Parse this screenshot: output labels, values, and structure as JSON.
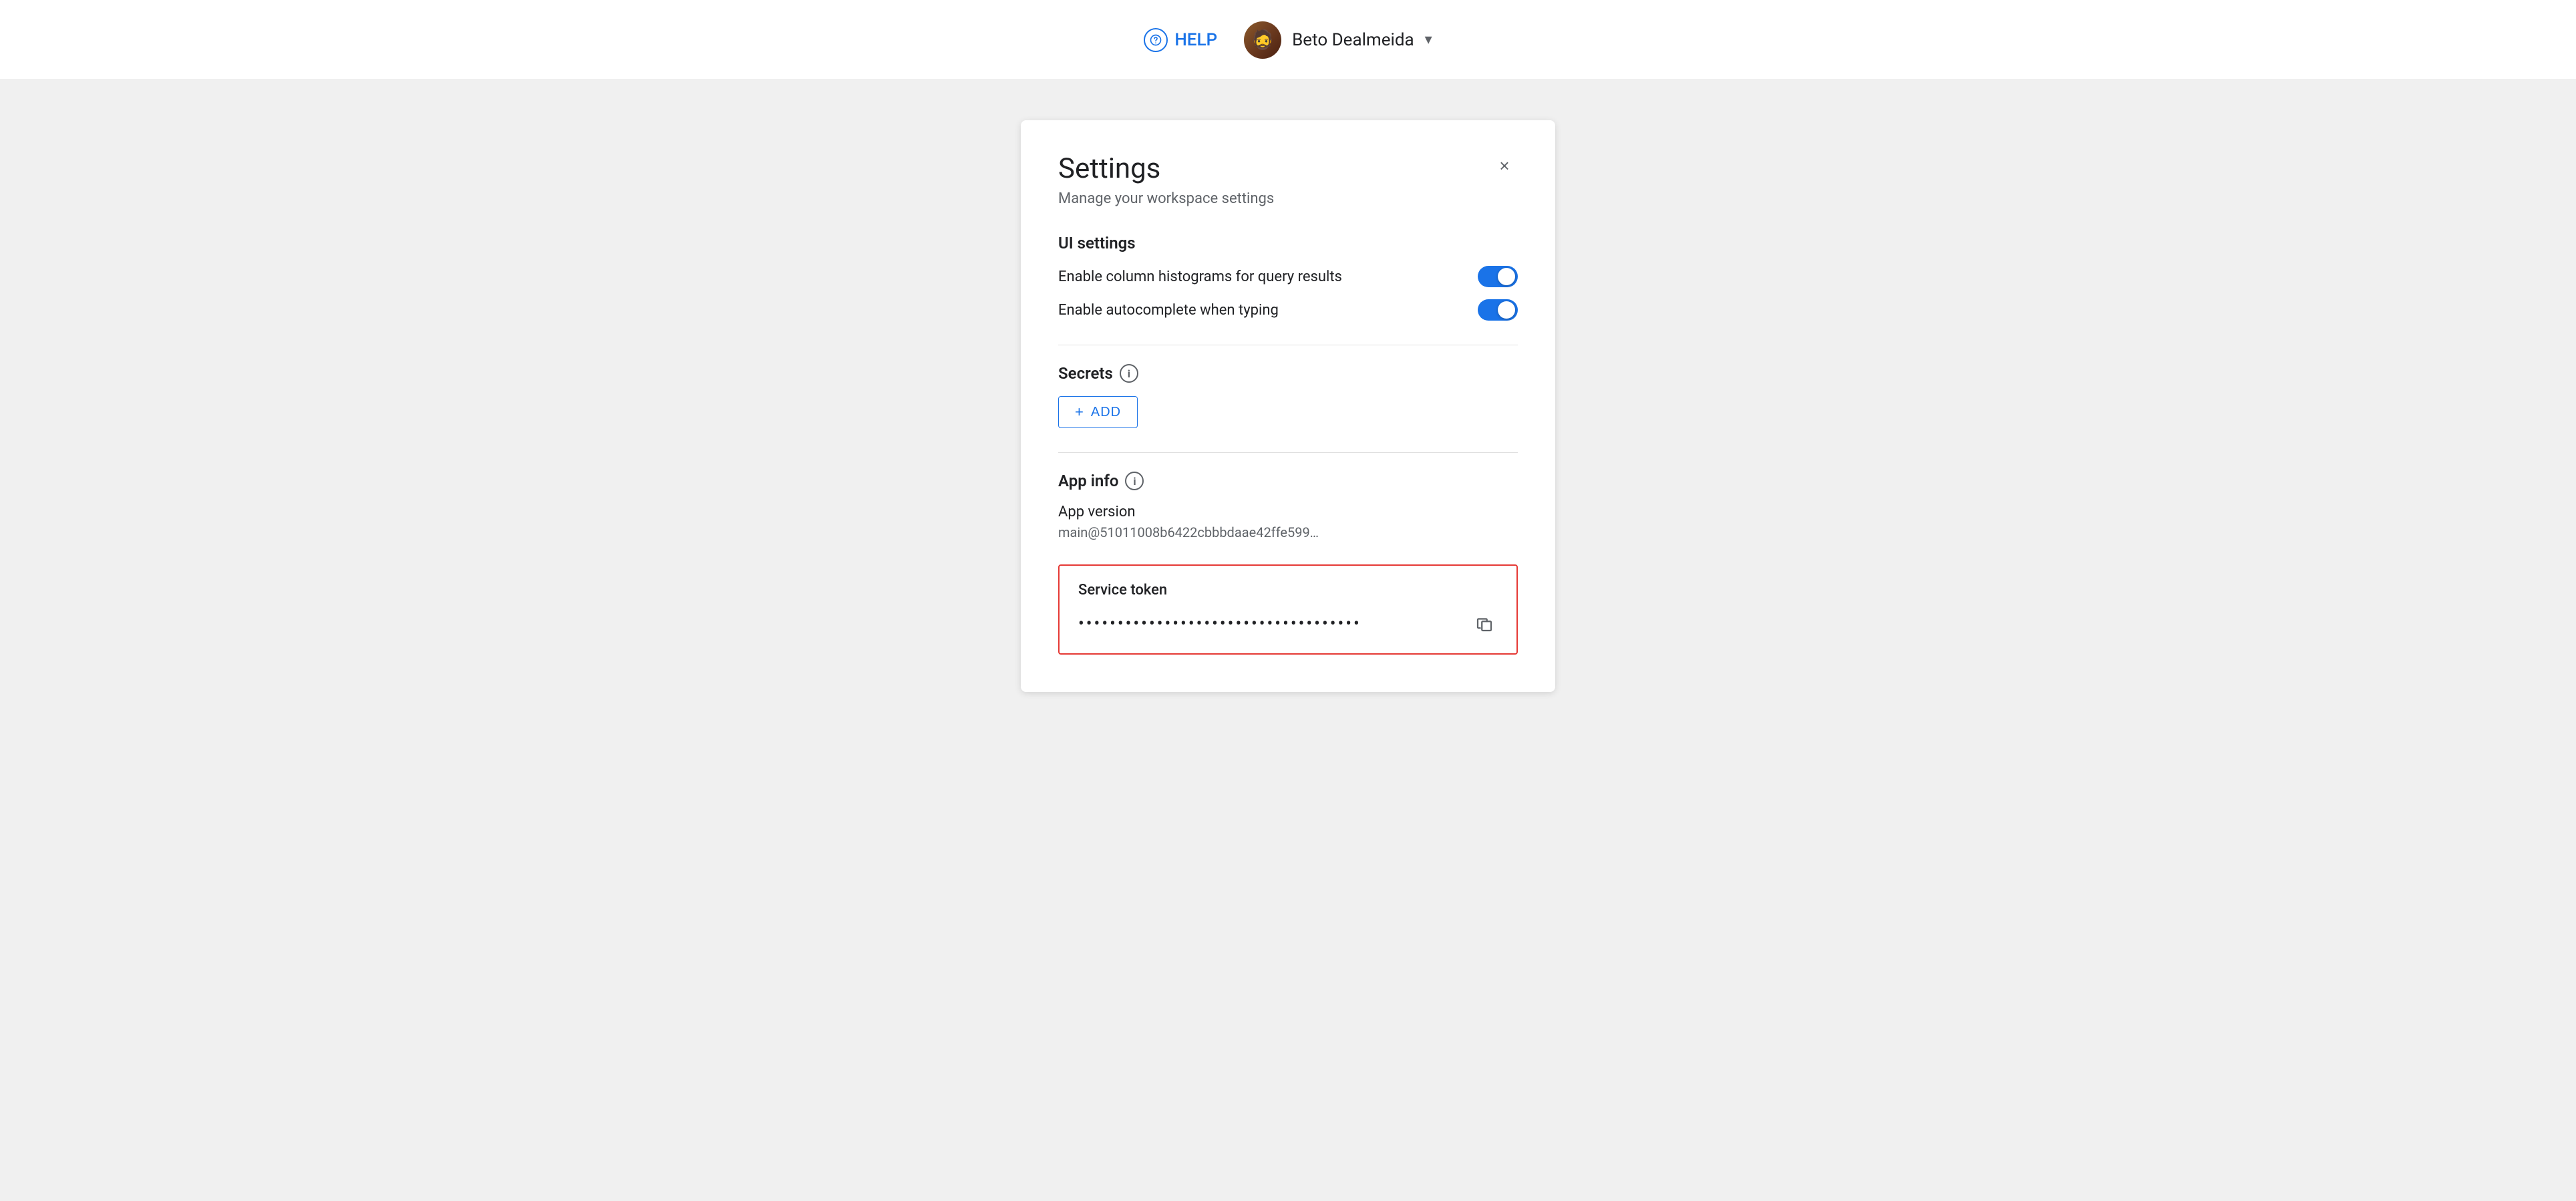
{
  "topbar": {
    "help_label": "HELP",
    "user_name": "Beto Dealmeida",
    "dropdown_symbol": "▾"
  },
  "settings": {
    "title": "Settings",
    "subtitle": "Manage your workspace settings",
    "close_label": "×",
    "ui_settings": {
      "section_title": "UI settings",
      "toggle1_label": "Enable column histograms for query results",
      "toggle2_label": "Enable autocomplete when typing"
    },
    "secrets": {
      "section_title": "Secrets",
      "add_button_label": "ADD"
    },
    "app_info": {
      "section_title": "App info",
      "app_version_label": "App version",
      "app_version_value": "main@51011008b6422cbbbdaae42ffe599…"
    },
    "service_token": {
      "section_title": "Service token",
      "token_dots": "••••••••••••••••••••••••••••••••••••"
    }
  },
  "icons": {
    "help": "💡",
    "info": "i",
    "copy": "copy"
  }
}
